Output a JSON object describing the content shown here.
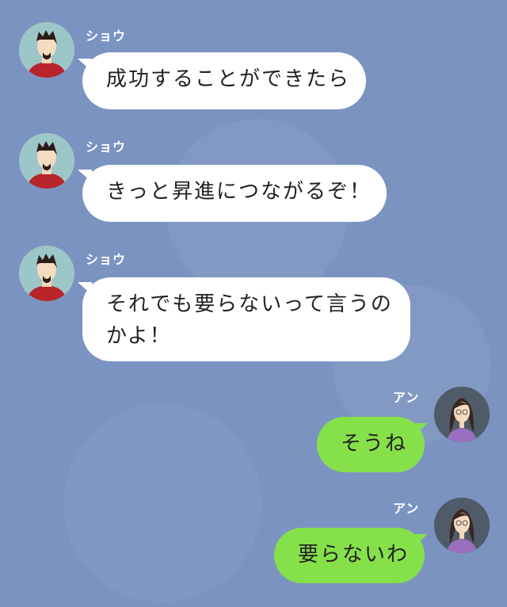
{
  "chat": {
    "background_color": "#7b93c1",
    "messages": [
      {
        "sender": "ショウ",
        "side": "left",
        "avatar_icon": "man-avatar-icon",
        "text": "成功することができたら"
      },
      {
        "sender": "ショウ",
        "side": "left",
        "avatar_icon": "man-avatar-icon",
        "text": "きっと昇進につながるぞ！"
      },
      {
        "sender": "ショウ",
        "side": "left",
        "avatar_icon": "man-avatar-icon",
        "text_line1": "それでも要らないって言うの",
        "text_line2": "かよ！"
      },
      {
        "sender": "アン",
        "side": "right",
        "avatar_icon": "woman-avatar-icon",
        "text": "そうね"
      },
      {
        "sender": "アン",
        "side": "right",
        "avatar_icon": "woman-avatar-icon",
        "text": "要らないわ"
      }
    ],
    "colors": {
      "left_bubble": "#ffffff",
      "right_bubble": "#86e04a",
      "name_text": "#ffffff"
    }
  }
}
